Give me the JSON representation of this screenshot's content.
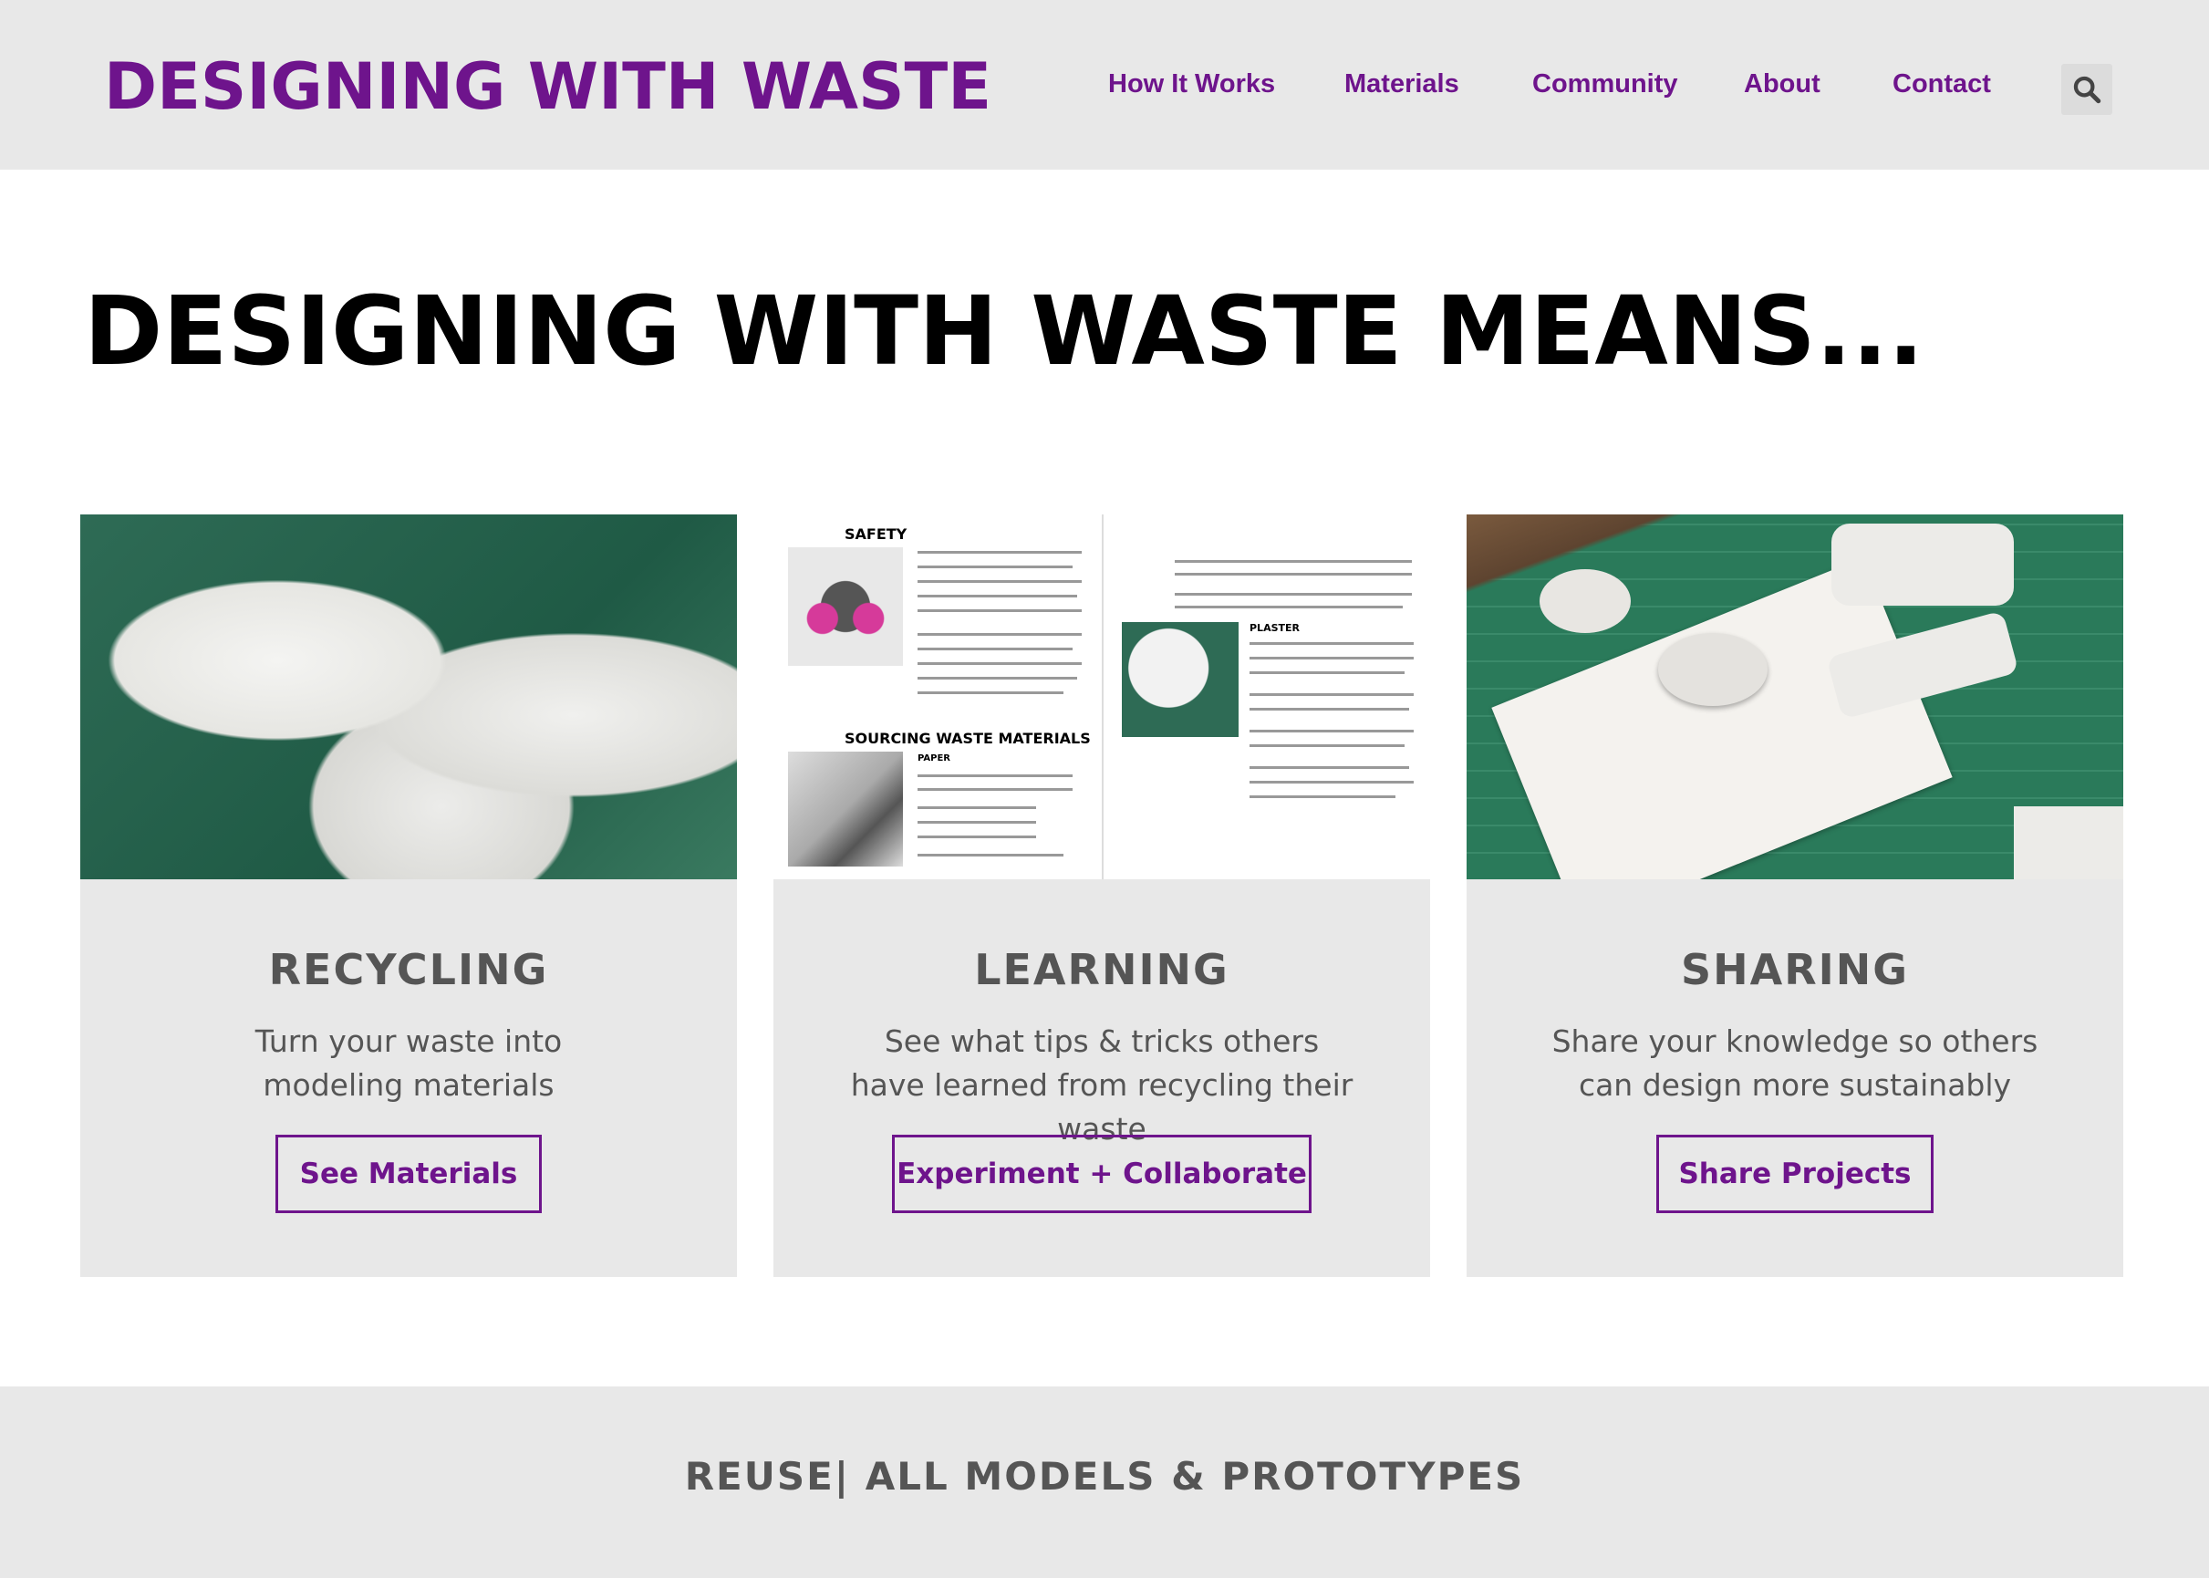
{
  "header": {
    "logo": "DESIGNING WITH WASTE",
    "nav": [
      "How It Works",
      "Materials",
      "Community",
      "About",
      "Contact"
    ],
    "search_icon": "search-icon"
  },
  "hero": {
    "title": "DESIGNING WITH WASTE MEANS..."
  },
  "cards": [
    {
      "title": "RECYCLING",
      "text": "Turn your waste into modeling materials",
      "button": "See Materials"
    },
    {
      "title": "LEARNING",
      "text": "See what tips & tricks others have learned from recycling their waste",
      "button": "Experiment + Collaborate",
      "doc": {
        "safety": "SAFETY",
        "sourcing": "SOURCING WASTE MATERIALS",
        "paper": "PAPER",
        "plaster": "PLASTER"
      }
    },
    {
      "title": "SHARING",
      "text": "Share your knowledge so others can design more sustainably",
      "button": "Share Projects"
    }
  ],
  "footer": {
    "text": "REUSE| ALL MODELS & PROTOTYPES"
  },
  "colors": {
    "brand": "#6e148c",
    "panel": "#e8e8e8",
    "text": "#555555"
  }
}
